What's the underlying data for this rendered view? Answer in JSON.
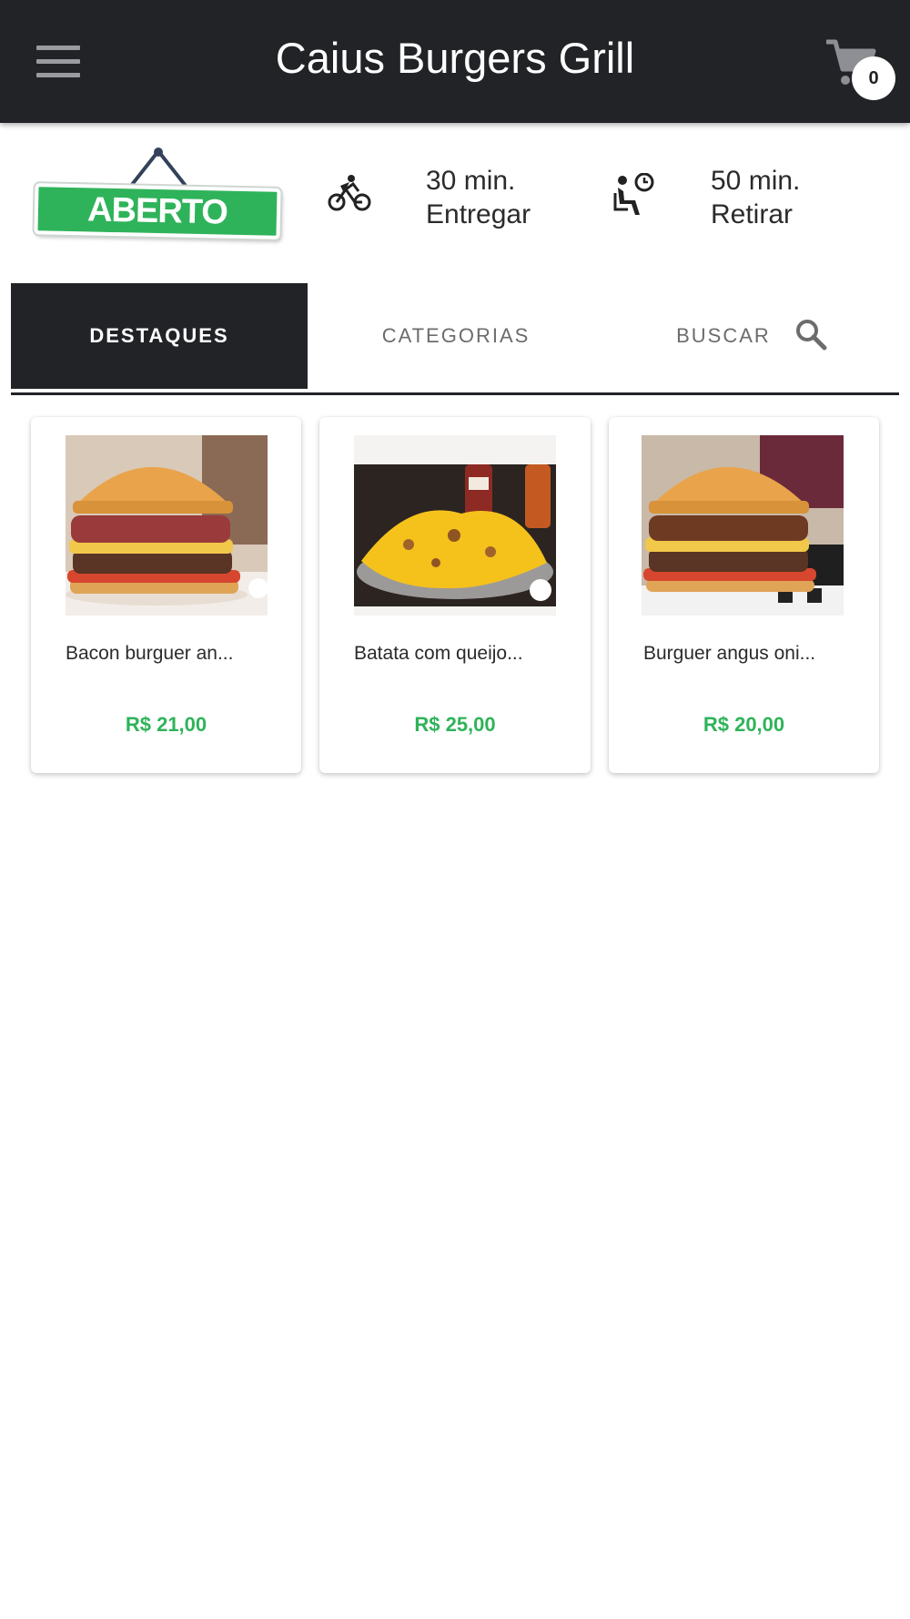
{
  "header": {
    "title": "Caius Burgers Grill",
    "menu_icon": "hamburger-menu-icon",
    "cart_icon": "shopping-cart-icon",
    "cart_count": "0"
  },
  "status": {
    "open_label": "ABERTO",
    "open_color": "#2fb35a",
    "delivery": {
      "icon": "delivery-bike-icon",
      "time": "30 min.",
      "label": "Entregar"
    },
    "pickup": {
      "icon": "pickup-clock-icon",
      "time": "50 min.",
      "label": "Retirar"
    }
  },
  "tabs": [
    {
      "label": "DESTAQUES",
      "active": true
    },
    {
      "label": "CATEGORIAS",
      "active": false
    },
    {
      "label": "BUSCAR",
      "active": false,
      "icon": "search-icon"
    }
  ],
  "products": [
    {
      "name": "Bacon burguer an...",
      "price": "R$ 21,00"
    },
    {
      "name": "Batata com queijo...",
      "price": "R$ 25,00"
    },
    {
      "name": "Burguer angus oni...",
      "price": "R$ 20,00"
    }
  ],
  "colors": {
    "header_bg": "#222327",
    "price": "#2fb35a",
    "accent": "#222327"
  }
}
